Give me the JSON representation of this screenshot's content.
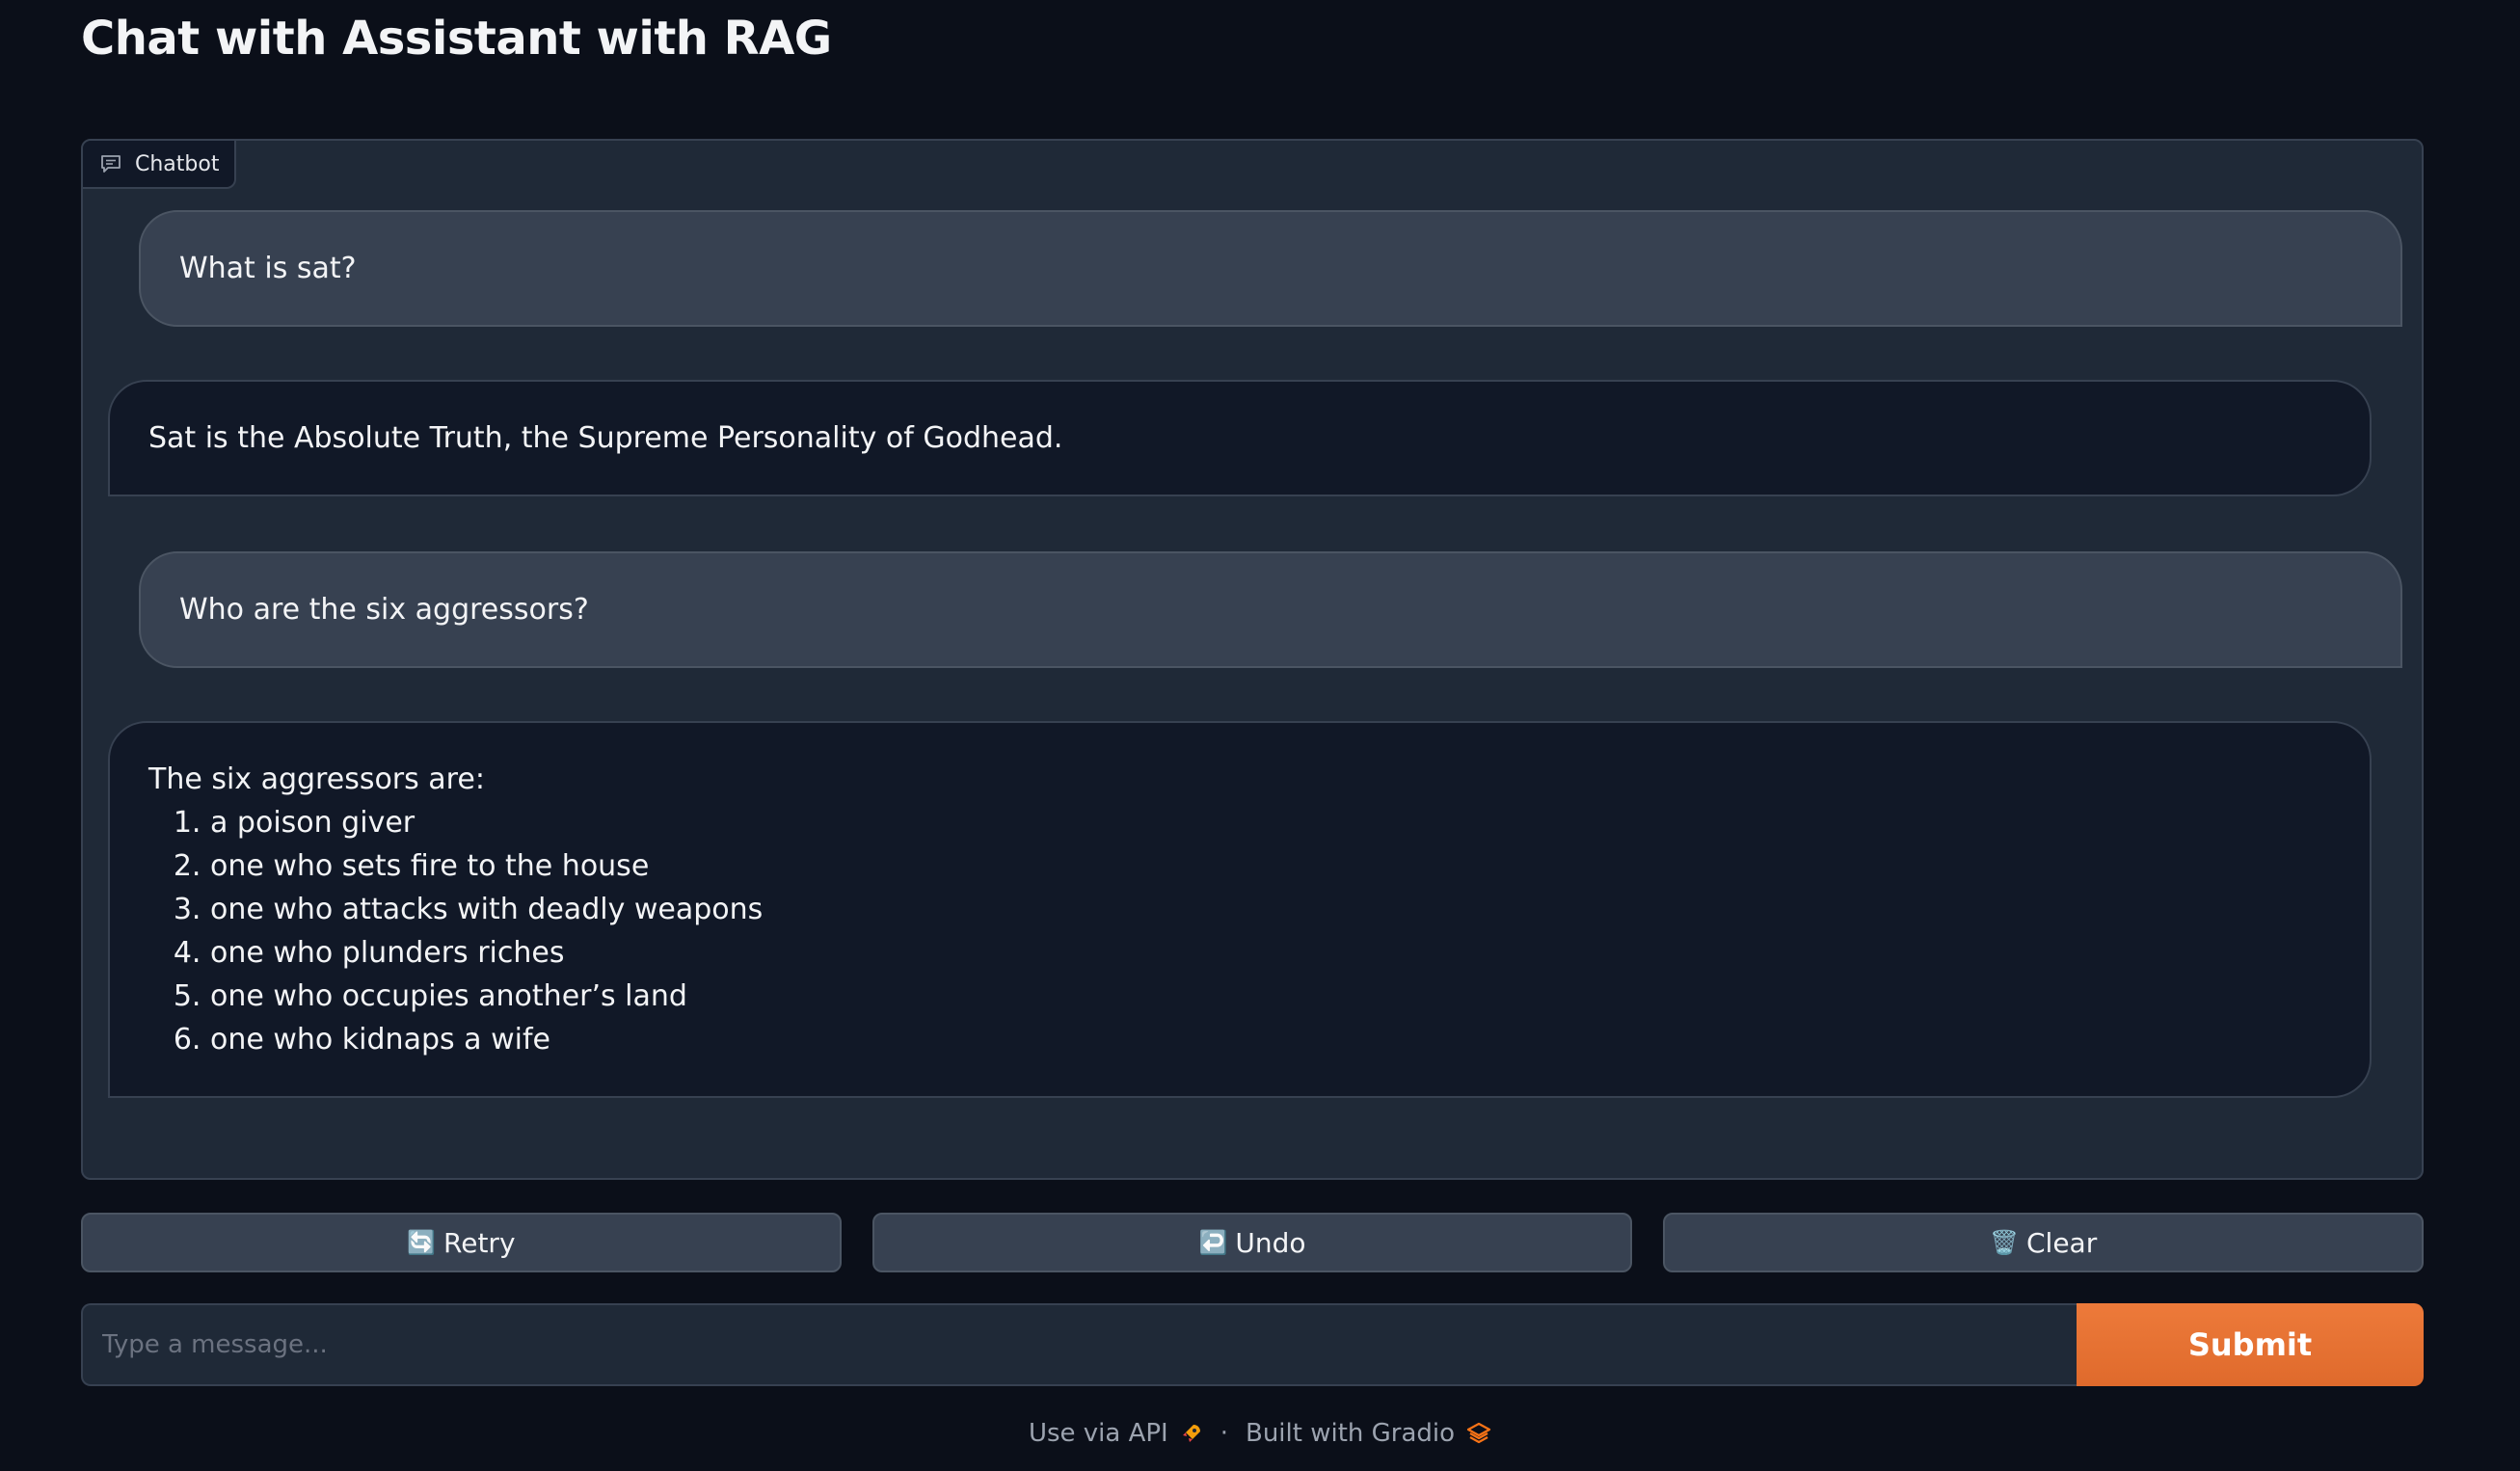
{
  "page": {
    "title": "Chat with Assistant with RAG"
  },
  "chatbot": {
    "label": "Chatbot",
    "label_icon": "chat-bubble-icon",
    "messages": [
      {
        "role": "user",
        "text": "What is sat?"
      },
      {
        "role": "bot",
        "text": "Sat is the Absolute Truth, the Supreme Personality of Godhead."
      },
      {
        "role": "user",
        "text": "Who are the six aggressors?"
      },
      {
        "role": "bot",
        "intro": "The six aggressors are:",
        "list": [
          "a poison giver",
          "one who sets fire to the house",
          "one who attacks with deadly weapons",
          "one who plunders riches",
          "one who occupies another’s land",
          "one who kidnaps a wife"
        ]
      }
    ]
  },
  "actions": {
    "retry": {
      "icon": "🔄",
      "label": "Retry"
    },
    "undo": {
      "icon": "↩️",
      "label": "Undo"
    },
    "clear": {
      "icon": "🗑️",
      "label": "Clear"
    }
  },
  "composer": {
    "placeholder": "Type a message...",
    "value": "",
    "submit_label": "Submit"
  },
  "footer": {
    "api_link": "Use via API",
    "api_icon": "rocket-icon",
    "separator": "·",
    "built_with": "Built with Gradio",
    "gradio_icon": "gradio-logo-icon"
  },
  "colors": {
    "background": "#0b0f19",
    "panel": "#1f2937",
    "user_bubble": "#374151",
    "bot_bubble": "#111827",
    "accent": "#e8702f"
  }
}
